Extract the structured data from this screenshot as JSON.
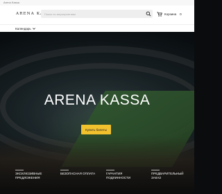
{
  "topbar": {
    "link": "Arena Kassa"
  },
  "header": {
    "logo": "ARENA KASSA",
    "search_placeholder": "Поиск по мероприятиям",
    "cart_label": "Корзина",
    "cart_count": "0"
  },
  "nav": {
    "calendar_label": "Календарь"
  },
  "hero": {
    "title": "ARENA KASSA",
    "cta_label": "Купить билеты"
  },
  "features": [
    {
      "label": "ЭКСКЛЮЗИВНЫЕ ПРЕДЛОЖЕНИЯ"
    },
    {
      "label": "БЕЗОПАСНАЯ ОПЛАТА"
    },
    {
      "label": "ГАРАНТИЯ ПОДЛИННОСТИ"
    },
    {
      "label": "ПРЕДВАРИТЕЛЬНЫЙ ЗАКАЗ"
    }
  ],
  "colors": {
    "accent": "#f2c12e",
    "header_bg": "#ffffff",
    "search_bg": "#eeeeee"
  },
  "icons": {
    "search": "search-icon",
    "cart": "cart-icon",
    "dropdown": "chevron-down-icon"
  }
}
